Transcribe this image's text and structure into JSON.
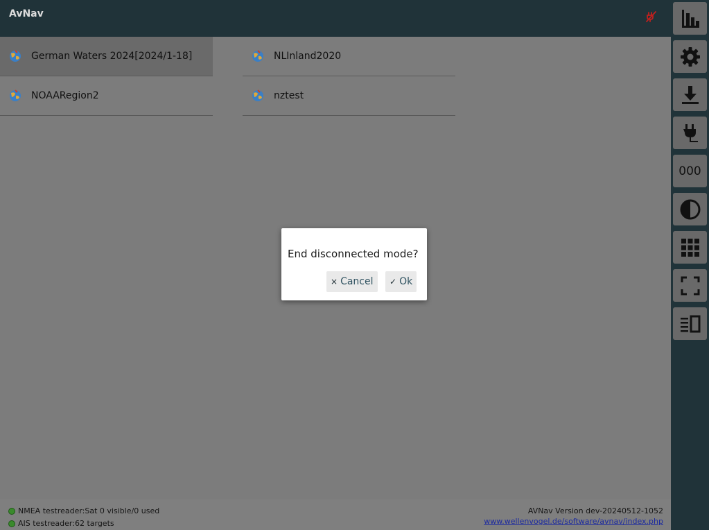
{
  "header": {
    "title": "AvNav",
    "status_icon": "disconnected-plug-icon",
    "status_color": "#c0201e"
  },
  "charts": [
    {
      "label": "German Waters 2024[2024/1-18]",
      "icon": "chart-globe-icon",
      "selected": true
    },
    {
      "label": "NLInland2020",
      "icon": "chart-globe-icon",
      "selected": false
    },
    {
      "label": "NOAARegion2",
      "icon": "chart-globe-icon",
      "selected": false
    },
    {
      "label": "nztest",
      "icon": "chart-globe-icon",
      "selected": false
    }
  ],
  "dialog": {
    "message": "End disconnected mode?",
    "cancel_icon": "×",
    "cancel_label": "Cancel",
    "ok_icon": "✓",
    "ok_label": "Ok"
  },
  "footer": {
    "nmea_status": "NMEA testreader:Sat 0 visible/0 used",
    "ais_status": "AIS testreader:62 targets",
    "version": "AVNav Version dev-20240512-1052",
    "link": "www.wellenvogel.de/software/avnav/index.php",
    "status_color": "#3a8a2c"
  },
  "sidebar": {
    "buttons": [
      {
        "name": "dashboard-button",
        "icon": "bar-chart-icon"
      },
      {
        "name": "settings-button",
        "icon": "gear-icon"
      },
      {
        "name": "download-button",
        "icon": "download-icon"
      },
      {
        "name": "connection-button",
        "icon": "plug-icon"
      },
      {
        "name": "ais-button",
        "icon": "text-icon",
        "text": "000"
      },
      {
        "name": "night-mode-button",
        "icon": "contrast-icon"
      },
      {
        "name": "apps-button",
        "icon": "grid-icon"
      },
      {
        "name": "fullscreen-button",
        "icon": "fullscreen-icon"
      },
      {
        "name": "split-mode-button",
        "icon": "split-view-icon"
      }
    ]
  }
}
